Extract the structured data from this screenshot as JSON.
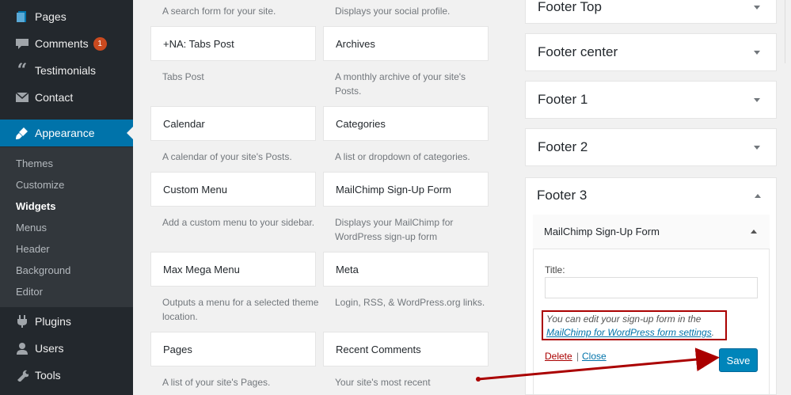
{
  "sidebar": {
    "items": [
      {
        "label": "Pages",
        "icon": "pages-icon"
      },
      {
        "label": "Comments",
        "icon": "comments-icon",
        "badge": "1"
      },
      {
        "label": "Testimonials",
        "icon": "quote-icon"
      },
      {
        "label": "Contact",
        "icon": "mail-icon"
      },
      {
        "label": "Appearance",
        "icon": "paintbrush-icon"
      },
      {
        "label": "Plugins",
        "icon": "plug-icon"
      },
      {
        "label": "Users",
        "icon": "users-icon"
      },
      {
        "label": "Tools",
        "icon": "wrench-icon"
      }
    ],
    "submenu": [
      "Themes",
      "Customize",
      "Widgets",
      "Menus",
      "Header",
      "Background",
      "Editor"
    ]
  },
  "widgets": {
    "top_desc_left": "A search form for your site.",
    "top_desc_right": "Displays your social profile.",
    "list": [
      {
        "title": "+NA: Tabs Post",
        "desc": "Tabs Post"
      },
      {
        "title": "Archives",
        "desc": "A monthly archive of your site's Posts."
      },
      {
        "title": "Calendar",
        "desc": "A calendar of your site's Posts."
      },
      {
        "title": "Categories",
        "desc": "A list or dropdown of categories."
      },
      {
        "title": "Custom Menu",
        "desc": "Add a custom menu to your sidebar."
      },
      {
        "title": "MailChimp Sign-Up Form",
        "desc": "Displays your MailChimp for WordPress sign-up form"
      },
      {
        "title": "Max Mega Menu",
        "desc": "Outputs a menu for a selected theme location."
      },
      {
        "title": "Meta",
        "desc": "Login, RSS, & WordPress.org links."
      },
      {
        "title": "Pages",
        "desc": "A list of your site's Pages."
      },
      {
        "title": "Recent Comments",
        "desc": "Your site's most recent"
      }
    ]
  },
  "areas": [
    "Footer Top",
    "Footer center",
    "Footer 1",
    "Footer 2",
    "Footer 3"
  ],
  "open_widget": {
    "title": "MailChimp Sign-Up Form",
    "title_label": "Title:",
    "title_value": "",
    "note_text": "You can edit your sign-up form in the",
    "note_link": "MailChimp for WordPress form settings",
    "note_end": ".",
    "delete": "Delete",
    "separator": "|",
    "close": "Close",
    "save": "Save"
  },
  "colors": {
    "admin_bar": "#23282d",
    "accent": "#0073aa",
    "badge": "#ca4a1f",
    "annotation": "#a00000"
  }
}
